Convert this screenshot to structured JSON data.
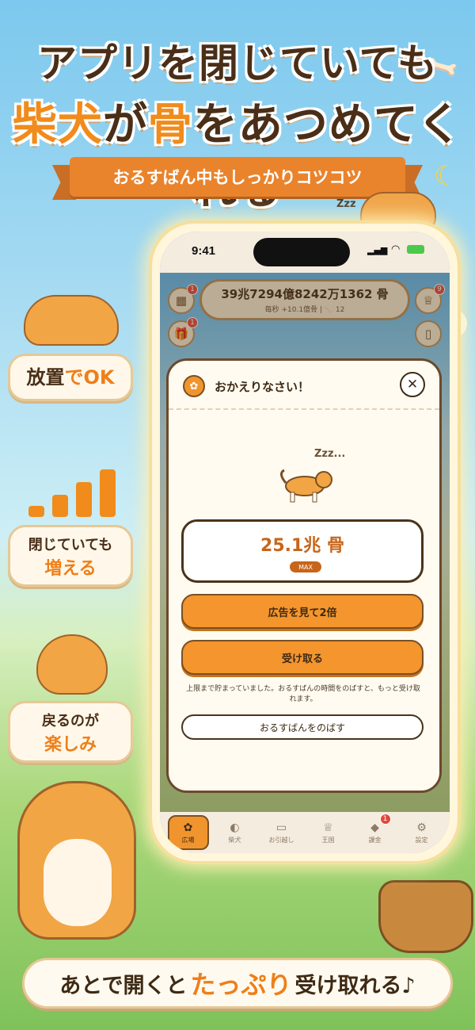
{
  "headline": {
    "line1": "アプリを閉じていても",
    "line2_part1": "柴犬",
    "line2_part2": "が",
    "line2_part3": "骨",
    "line2_part4": "をあつめてくれる"
  },
  "ribbon": "おるすばん中もしっかりコツコツ",
  "side_cards": [
    {
      "part1": "放置",
      "part2": "でOK"
    },
    {
      "line1": "閉じていても",
      "line2": "増える"
    },
    {
      "line1": "戻るのが",
      "line2": "楽しみ"
    }
  ],
  "phone": {
    "time": "9:41",
    "counter": {
      "value": "39兆7294億8242万1362 骨",
      "rate": "毎秒 +10.1億骨",
      "divider": "|",
      "dogs": "12"
    },
    "side_badges": {
      "calendar": "1",
      "gift": "1",
      "trophy": "9"
    },
    "modal": {
      "title": "おかえりなさい！",
      "zzz": "Zzz...",
      "amount": "25.1兆 骨",
      "max_label": "MAX",
      "ad_button": "広告を見て2倍",
      "receive_button": "受け取る",
      "note": "上限まで貯まっていました。おるすばんの時間をのばすと、もっと受け取れます。",
      "extend_button": "おるすばんをのばす"
    },
    "tabs": [
      {
        "label": "広場",
        "icon": "paw-icon",
        "active": true
      },
      {
        "label": "柴犬",
        "icon": "dog-icon",
        "active": false
      },
      {
        "label": "お引越し",
        "icon": "book-icon",
        "active": false
      },
      {
        "label": "王国",
        "icon": "trophy-icon",
        "active": false
      },
      {
        "label": "課金",
        "icon": "gem-icon",
        "active": false,
        "badge": "1"
      },
      {
        "label": "設定",
        "icon": "gear-icon",
        "active": false
      }
    ]
  },
  "bottom": {
    "part1": "あとで開くと",
    "part2": "たっぷり",
    "part3": "受け取れる♪"
  }
}
